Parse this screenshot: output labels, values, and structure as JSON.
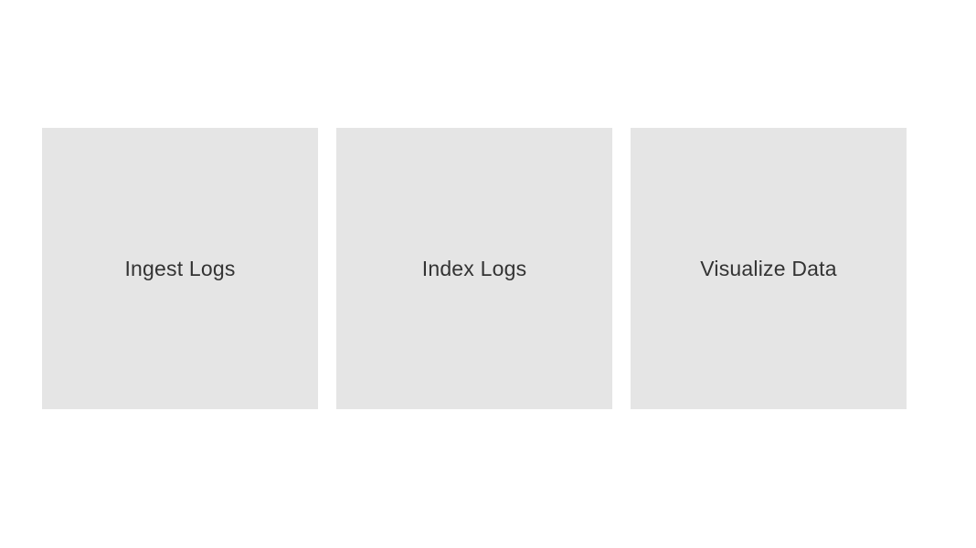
{
  "cards": [
    {
      "label": "Ingest Logs"
    },
    {
      "label": "Index Logs"
    },
    {
      "label": "Visualize Data"
    }
  ]
}
